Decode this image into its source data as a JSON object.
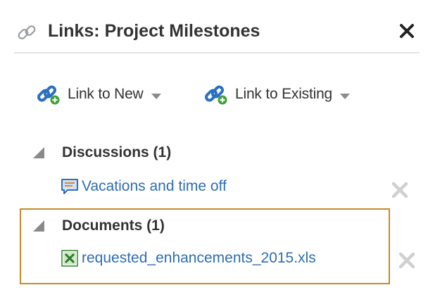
{
  "header": {
    "title": "Links: Project Milestones"
  },
  "toolbar": {
    "link_to_new_label": "Link to New",
    "link_to_existing_label": "Link to Existing"
  },
  "sections": [
    {
      "title": "Discussions (1)",
      "items": [
        {
          "label": "Vacations and time off",
          "icon": "discussion-icon"
        }
      ]
    },
    {
      "title": "Documents (1)",
      "items": [
        {
          "label": "requested_enhancements_2015.xls",
          "icon": "excel-file-icon"
        }
      ]
    }
  ],
  "colors": {
    "link": "#2e6db4",
    "text": "#333333",
    "highlight_border": "#c8892b",
    "remove_icon": "#d0d0d0",
    "divider": "#dfe3e8"
  }
}
